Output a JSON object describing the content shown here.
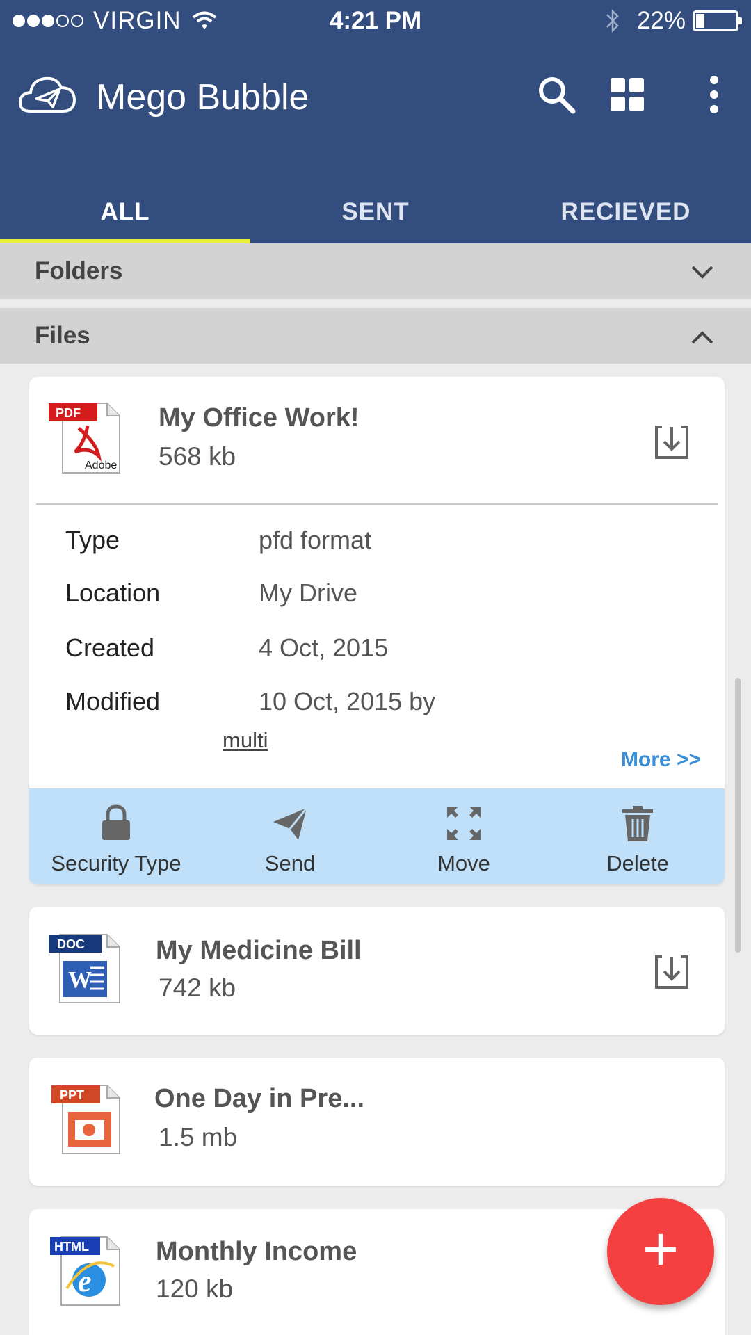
{
  "status_bar": {
    "carrier": "VIRGIN",
    "time": "4:21 PM",
    "battery": "22%",
    "battery_level": 0.22
  },
  "app_bar": {
    "title": "Mego Bubble",
    "icons": [
      "cloud-send-logo-icon",
      "search-icon",
      "grid-view-icon",
      "more-vert-icon"
    ]
  },
  "tabs": [
    {
      "label": "ALL",
      "active": true
    },
    {
      "label": "SENT",
      "active": false
    },
    {
      "label": "RECIEVED",
      "active": false
    }
  ],
  "sections": {
    "folders": {
      "label": "Folders",
      "expanded": false
    },
    "files": {
      "label": "Files",
      "expanded": true
    }
  },
  "files": [
    {
      "title": "My Office Work!",
      "size": "568 kb",
      "icon": "pdf-file-icon",
      "badge": "PDF",
      "icon_caption": "Adobe",
      "details": {
        "type_label": "Type",
        "type_value": "pfd format",
        "location_label": "Location",
        "location_value": "My Drive",
        "created_label": "Created",
        "created_value": "4 Oct, 2015",
        "modified_label": "Modified",
        "modified_value": "10 Oct, 2015  by",
        "modified_by": "multi",
        "more_link": "More >>"
      },
      "actions": [
        {
          "label": "Security Type",
          "icon": "lock-icon"
        },
        {
          "label": "Send",
          "icon": "send-icon"
        },
        {
          "label": "Move",
          "icon": "move-icon"
        },
        {
          "label": "Delete",
          "icon": "trash-icon"
        }
      ]
    },
    {
      "title": "My Medicine Bill",
      "size": "742 kb",
      "icon": "doc-file-icon",
      "badge": "DOC"
    },
    {
      "title": "One Day in Pre...",
      "size": "1.5 mb",
      "icon": "ppt-file-icon",
      "badge": "PPT"
    },
    {
      "title": "Monthly Income",
      "size": "120 kb",
      "icon": "html-file-icon",
      "badge": "HTML"
    }
  ],
  "fab": {
    "label": "+",
    "color": "#f44040"
  },
  "colors": {
    "header": "#324d7e",
    "tab_indicator": "#e8ef3b",
    "actions_bg": "#bfe0f8",
    "link": "#3a8fd6"
  }
}
